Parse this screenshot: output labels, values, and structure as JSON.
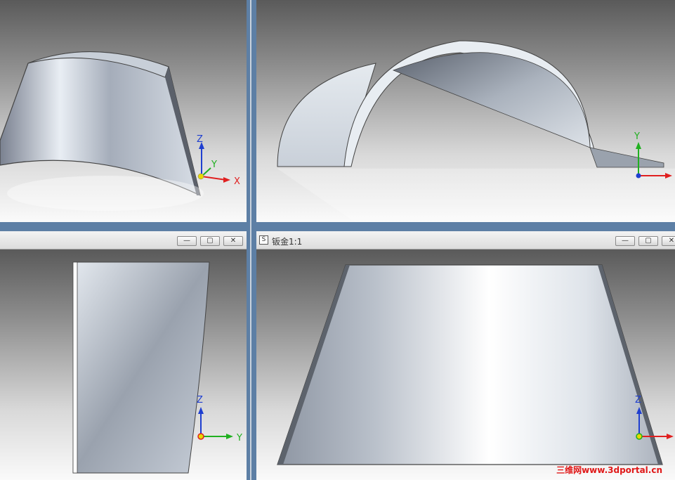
{
  "viewports": {
    "top_left": {
      "axes": {
        "z": "Z",
        "y": "Y",
        "x": "X"
      }
    },
    "top_right": {
      "axes": {
        "y": "Y"
      }
    },
    "bottom_left": {
      "axes": {
        "z": "Z",
        "y": "Y"
      },
      "buttons": {
        "minimize": "—",
        "restore": "▢",
        "close": "✕"
      }
    },
    "bottom_right": {
      "title": "钣金1:1",
      "doc_icon": "S",
      "axes": {
        "z": "Z"
      },
      "buttons": {
        "minimize": "—",
        "restore": "▢",
        "close": "✕"
      }
    }
  },
  "watermark": "三维网www.3dportal.cn",
  "colors": {
    "axis_x": "#e02020",
    "axis_y": "#20b020",
    "axis_z": "#1f3fd0",
    "origin": "#e8d800",
    "frame": "#5d7fa5"
  }
}
